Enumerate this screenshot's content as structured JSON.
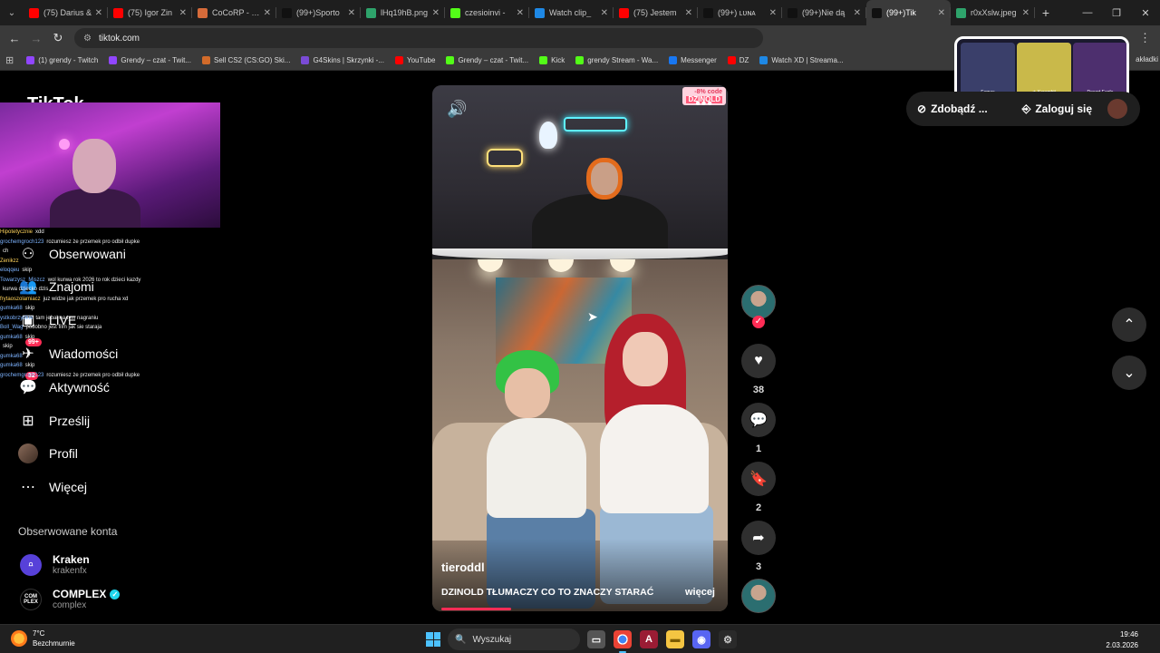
{
  "tabs": [
    {
      "label": "(75) Darius &",
      "color": "#ff0000",
      "active": false
    },
    {
      "label": "(75) Igor Zin",
      "color": "#ff0000",
      "active": false
    },
    {
      "label": "CoCoRP - Po",
      "color": "#d66b3a",
      "active": false
    },
    {
      "label": "(99+)Sporto",
      "color": "#111111",
      "active": false
    },
    {
      "label": "lHq19hB.png",
      "color": "#2ea36b",
      "active": false
    },
    {
      "label": "czesioinvi - ",
      "color": "#53fc18",
      "active": false
    },
    {
      "label": "Watch clip_",
      "color": "#1e88e5",
      "active": false
    },
    {
      "label": "(75) Jestem",
      "color": "#ff0000",
      "active": false
    },
    {
      "label": "(99+) ʟᴜɴᴀ",
      "color": "#111111",
      "active": false
    },
    {
      "label": "(99+)Nie dą",
      "color": "#111111",
      "active": false
    },
    {
      "label": "(99+)Tik",
      "color": "#111111",
      "active": true
    },
    {
      "label": "r0xXslw.jpeg",
      "color": "#2ea36b",
      "active": false
    }
  ],
  "address": {
    "url": "tiktok.com"
  },
  "bookmarks": [
    {
      "label": "(1) grendy - Twitch",
      "color": "#9146ff"
    },
    {
      "label": "Grendy – czat - Twit...",
      "color": "#9146ff"
    },
    {
      "label": "Sell CS2 (CS:GO) Ski...",
      "color": "#d26b2a"
    },
    {
      "label": "G4Skins | Skrzynki -...",
      "color": "#7a4bd6"
    },
    {
      "label": "YouTube",
      "color": "#ff0000"
    },
    {
      "label": "Grendy – czat - Twit...",
      "color": "#53fc18"
    },
    {
      "label": "Kick",
      "color": "#53fc18"
    },
    {
      "label": "grendy Stream - Wa...",
      "color": "#53fc18"
    },
    {
      "label": "Messenger",
      "color": "#1877f2"
    },
    {
      "label": "DZ",
      "color": "#ff0000"
    },
    {
      "label": "Watch XD | Streama...",
      "color": "#1e88e5"
    }
  ],
  "bookmarks_right": "akładki",
  "sidebar": {
    "logo": "TikTok",
    "nav": [
      {
        "label": "Obserwowani",
        "icon": "following-icon"
      },
      {
        "label": "Znajomi",
        "icon": "friends-icon"
      },
      {
        "label": "LIVE",
        "icon": "live-icon"
      },
      {
        "label": "Wiadomości",
        "icon": "messages-icon",
        "badge": "99+"
      },
      {
        "label": "Aktywność",
        "icon": "activity-icon",
        "badge": "32"
      },
      {
        "label": "Prześlij",
        "icon": "upload-icon"
      },
      {
        "label": "Profil",
        "icon": "profile-avatar"
      },
      {
        "label": "Więcej",
        "icon": "more-icon"
      }
    ],
    "section_title": "Obserwowane konta",
    "accounts": [
      {
        "name": "Kraken",
        "handle": "krakenfx"
      },
      {
        "name": "COMPLEX",
        "handle": "complex",
        "verified": true,
        "avatar_text": "COM PLEX"
      }
    ]
  },
  "chat": [
    {
      "user": "Hipotetycznie",
      "text": "xdd",
      "yellow": true
    },
    {
      "user": "grochemgroch123",
      "text": "rozumiesz że przemek pro odbił dupke",
      "yellow": false
    },
    {
      "user": "",
      "text": "ch",
      "yellow": false
    },
    {
      "user": "Zenikzz",
      "text": "",
      "yellow": true
    },
    {
      "user": "eloqqeu",
      "text": "skip",
      "yellow": false
    },
    {
      "user": "Towarzysz_Miszcz",
      "text": "wol kurwa rok 2026 to rok dzieci kazdy",
      "yellow": false
    },
    {
      "user": "",
      "text": "kurwa dziecko dzis",
      "yellow": false
    },
    {
      "user": "frytaoszolamiacz",
      "text": "juz widze jak przemek pro rucha xd",
      "yellow": true
    },
    {
      "user": "gumka68",
      "text": "skip",
      "yellow": false
    },
    {
      "user": "ystkobrzydkie",
      "text": "tam jebał na tym nagraniu",
      "yellow": false
    },
    {
      "user": "Boll_Wag",
      "text": "podobno jest film jak sie staraja",
      "yellow": false
    },
    {
      "user": "gumka68",
      "text": "skip",
      "yellow": false
    },
    {
      "user": "",
      "text": "skip",
      "yellow": false
    },
    {
      "user": "gumka68",
      "text": "",
      "yellow": false
    },
    {
      "user": "gumka68",
      "text": "skip",
      "yellow": false
    },
    {
      "user": "grochemgroch123",
      "text": "rozumiesz że przemek pro odbił dupke",
      "yellow": false
    }
  ],
  "overlay_skins": [
    {
      "name": "Famas",
      "rarity": "Sergeant",
      "color": "#3a3f6a"
    },
    {
      "name": "★ Karambit",
      "rarity": "Case Hardened",
      "color": "#c9b94a"
    },
    {
      "name": "Desert Eagle",
      "rarity": "Kumicho Dragon",
      "color": "#4d2f6e"
    }
  ],
  "video": {
    "promo_label": "-8% code",
    "promo_code": "DZINOLD",
    "author": "tieroddl",
    "caption": "DZINOLD TŁUMACZY CO TO ZNACZY STARAĆ",
    "more": "więcej",
    "progress": 0.25
  },
  "actions": {
    "likes": "38",
    "comments": "1",
    "saves": "2",
    "shares": "3"
  },
  "top_pill": {
    "left_label": "Zdobądź ...",
    "right_label": "Zaloguj się"
  },
  "taskbar": {
    "temperature": "7°C",
    "weather": "Bezchmurnie",
    "search": "Wyszukaj",
    "time": "19:46",
    "date": "2.03.2026"
  }
}
